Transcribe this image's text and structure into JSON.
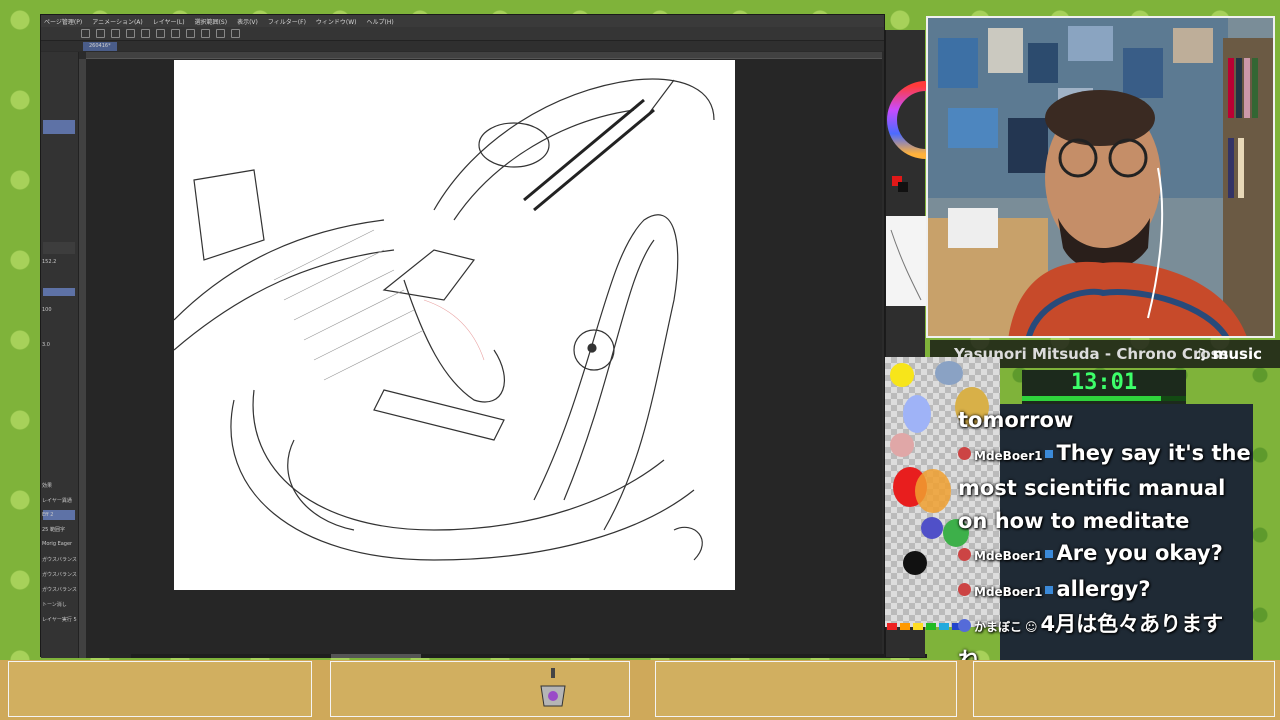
{
  "app": {
    "menu": [
      "ページ管理(P)",
      "アニメーション(A)",
      "レイヤー(L)",
      "選択範囲(S)",
      "表示(V)",
      "フィルター(F)",
      "ウィンドウ(W)",
      "ヘルプ(H)"
    ],
    "doc_tab": "260416*",
    "left_panel": {
      "zoom": "152.2",
      "opacity": "100",
      "value": "3.0",
      "layers": [
        "効果",
        "レイヤー異通",
        "Eff 2",
        "25 範囲字",
        "Morig Eager",
        "ガウスバランス",
        "ガウスバランス",
        "ガウスバランス",
        "トーン消し",
        "レイヤー実行 5"
      ]
    }
  },
  "music": {
    "song": "Yasunori Mitsuda - Chrono Cross",
    "label": "♫ music"
  },
  "timer": {
    "time": "13:01",
    "progress": 0.85
  },
  "chat": [
    {
      "text": "tomorrow"
    },
    {
      "user": "MdeBoer1",
      "text": "They say it's the"
    },
    {
      "text": "most scientific manual"
    },
    {
      "text": "on how to meditate"
    },
    {
      "user": "MdeBoer1",
      "text": "Are you okay?"
    },
    {
      "user": "MdeBoer1",
      "text": "allergy?"
    },
    {
      "user": "かまぼこ",
      "text": "4月は色々あります"
    },
    {
      "text": "ね"
    }
  ],
  "colors": {
    "accent": "#5e72a6",
    "timer": "#3dff6a"
  }
}
